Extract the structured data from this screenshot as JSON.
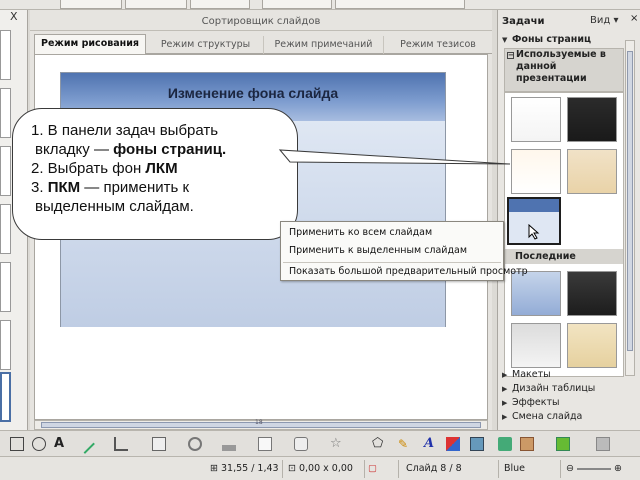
{
  "editor": {
    "title": "Сортировщик слайдов",
    "tabs": [
      {
        "label": "Режим рисования"
      },
      {
        "label": "Режим структуры"
      },
      {
        "label": "Режим примечаний"
      },
      {
        "label": "Режим тезисов"
      }
    ],
    "slide_title": "Изменение фона слайда",
    "scroll_label": "18"
  },
  "callout": {
    "line1": "1. В панели задач выбрать",
    "line2_pre": "вкладку — ",
    "line2_bold": "фоны страниц.",
    "line3_pre": "2. Выбрать фон ",
    "line3_bold": "ЛКМ",
    "line4_pre": "3. ",
    "line4_bold": "ПКМ",
    "line4_post": " — применить к",
    "line5": "выделенным слайдам."
  },
  "context_menu": {
    "items": [
      {
        "label": "Применить ко всем слайдам"
      },
      {
        "label": "Применить к выделенным слайдам"
      },
      {
        "label": "Показать большой предварительный просмотр"
      }
    ]
  },
  "taskpane": {
    "title": "Задачи",
    "view": "Вид",
    "close": "×",
    "section_master": "Фоны страниц",
    "used_in": "Используемые в данной презентации",
    "recent": "Последние",
    "collapsed": [
      {
        "label": "Макеты"
      },
      {
        "label": "Дизайн таблицы"
      },
      {
        "label": "Эффекты"
      },
      {
        "label": "Смена слайда"
      }
    ]
  },
  "leftpane": {
    "close": "X"
  },
  "statusbar": {
    "position": "31,55 / 1,43",
    "size": "0,00 x 0,00",
    "slide": "Слайд 8 / 8",
    "master": "Blue"
  },
  "colors": {
    "slide_header": "#4f73b0",
    "selection": "#1e1e1e",
    "callout_border": "#3a3a3a"
  }
}
